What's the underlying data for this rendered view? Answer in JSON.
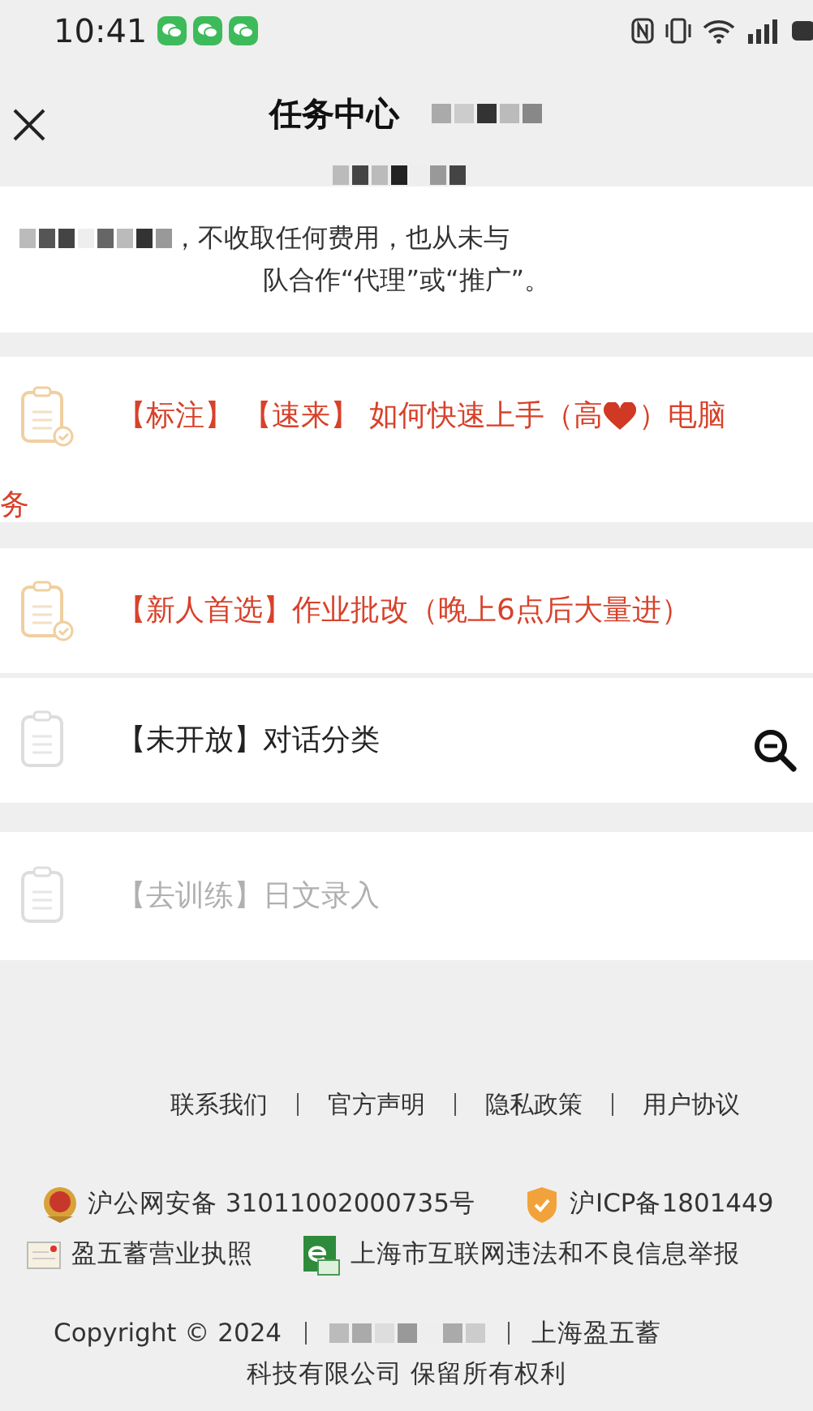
{
  "status_bar": {
    "time": "10:41",
    "notifications": [
      {
        "kind": "chat"
      },
      {
        "kind": "chat"
      },
      {
        "kind": "chat"
      }
    ]
  },
  "header": {
    "title": "任务中心"
  },
  "notice": {
    "line_1": "，不收取任何费用，也从未与",
    "line_2": "队合作“代理”或“推广”。"
  },
  "tasks": [
    {
      "kind": "hot",
      "title": "【标注】 【速来】 如何快速上手（高",
      "title_after_heart": "）电脑",
      "title_wrap": "务"
    },
    {
      "kind": "hot",
      "title": "【新人首选】作业批改（晚上6点后大量进）"
    },
    {
      "kind": "closed",
      "title": "【未开放】对话分类"
    },
    {
      "kind": "training",
      "title": "【去训练】日文录入"
    }
  ],
  "footer": {
    "links": [
      "联系我们",
      "官方声明",
      "隐私政策",
      "用户协议"
    ],
    "records": [
      {
        "kind": "police",
        "text": "沪公网安备 31011002000735号"
      },
      {
        "kind": "icp",
        "text": "沪ICP备1801449"
      },
      {
        "kind": "license",
        "text": "盈五蓄营业执照"
      },
      {
        "kind": "report",
        "text": "上海市互联网违法和不良信息举报"
      }
    ],
    "copyright": "Copyright © 2024",
    "company_start": "上海盈五蓄",
    "company_end": "科技有限公司 保留所有权利"
  }
}
